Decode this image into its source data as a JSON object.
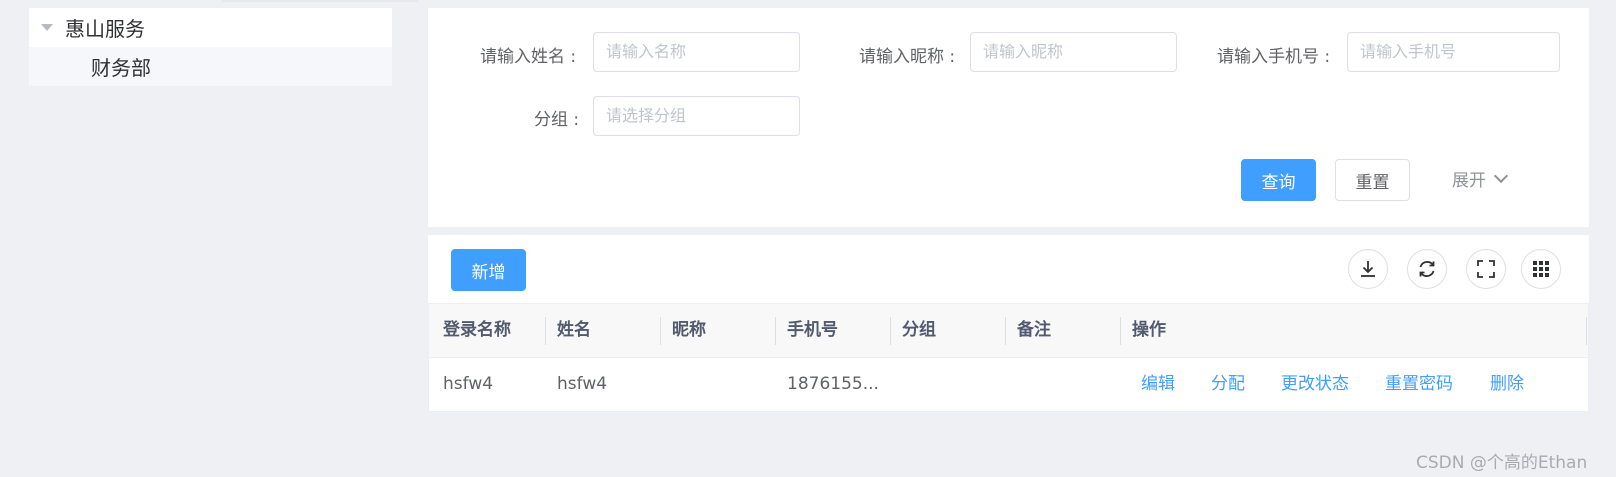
{
  "tree": {
    "root_label": "惠山服务",
    "child_label": "财务部"
  },
  "search": {
    "name_label": "请输入姓名 :",
    "name_placeholder": "请输入名称",
    "nickname_label": "请输入昵称 :",
    "nickname_placeholder": "请输入昵称",
    "phone_label": "请输入手机号 :",
    "phone_placeholder": "请输入手机号",
    "group_label": "分组 :",
    "group_placeholder": "请选择分组",
    "query_button": "查询",
    "reset_button": "重置",
    "expand_label": "展开"
  },
  "toolbar": {
    "add_button": "新增",
    "tools": [
      "download-icon",
      "refresh-icon",
      "fullscreen-icon",
      "columns-grid-icon"
    ]
  },
  "table": {
    "headers": [
      "登录名称",
      "姓名",
      "昵称",
      "手机号",
      "分组",
      "备注",
      "操作"
    ],
    "rows": [
      {
        "login": "hsfw4",
        "name": "hsfw4",
        "nickname": "",
        "phone": "1876155...",
        "group": "",
        "remark": "",
        "actions": [
          "编辑",
          "分配",
          "更改状态",
          "重置密码",
          "删除"
        ]
      }
    ]
  },
  "colors": {
    "primary": "#409eff",
    "background": "#eff0f3"
  },
  "watermark": "CSDN @个高的Ethan"
}
